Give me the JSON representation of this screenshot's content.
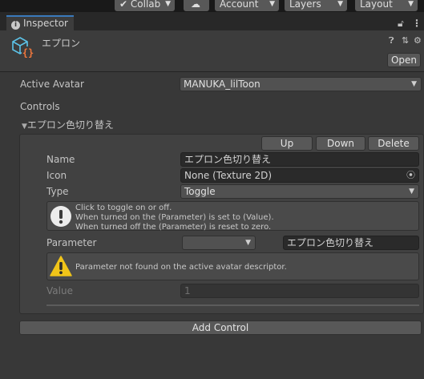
{
  "toolbar": {
    "collab_label": "Collab",
    "account_label": "Account",
    "layers_label": "Layers",
    "layout_label": "Layout"
  },
  "tab": {
    "title": "Inspector"
  },
  "component": {
    "name": "エプロン",
    "open_label": "Open"
  },
  "avatar": {
    "label": "Active Avatar",
    "value": "MANUKA_lilToon"
  },
  "controls": {
    "section_label": "Controls",
    "item_title": "エプロン色切り替え",
    "up_label": "Up",
    "down_label": "Down",
    "delete_label": "Delete",
    "name_label": "Name",
    "name_value": "エプロン色切り替え",
    "icon_label": "Icon",
    "icon_value": "None (Texture 2D)",
    "type_label": "Type",
    "type_value": "Toggle",
    "info_lines": [
      "Click to toggle on or off.",
      "When turned on the (Parameter) is set to (Value).",
      "When turned off the (Parameter) is reset to zero."
    ],
    "parameter_label": "Parameter",
    "parameter_dropdown_value": "",
    "parameter_value": "エプロン色切り替え",
    "warning_text": "Parameter not found on the active avatar descriptor.",
    "value_label": "Value",
    "value_value": "1",
    "add_control_label": "Add Control"
  },
  "colors": {
    "background": "#383838",
    "tab_accent": "#3a79bb",
    "warning": "#f0c419"
  }
}
